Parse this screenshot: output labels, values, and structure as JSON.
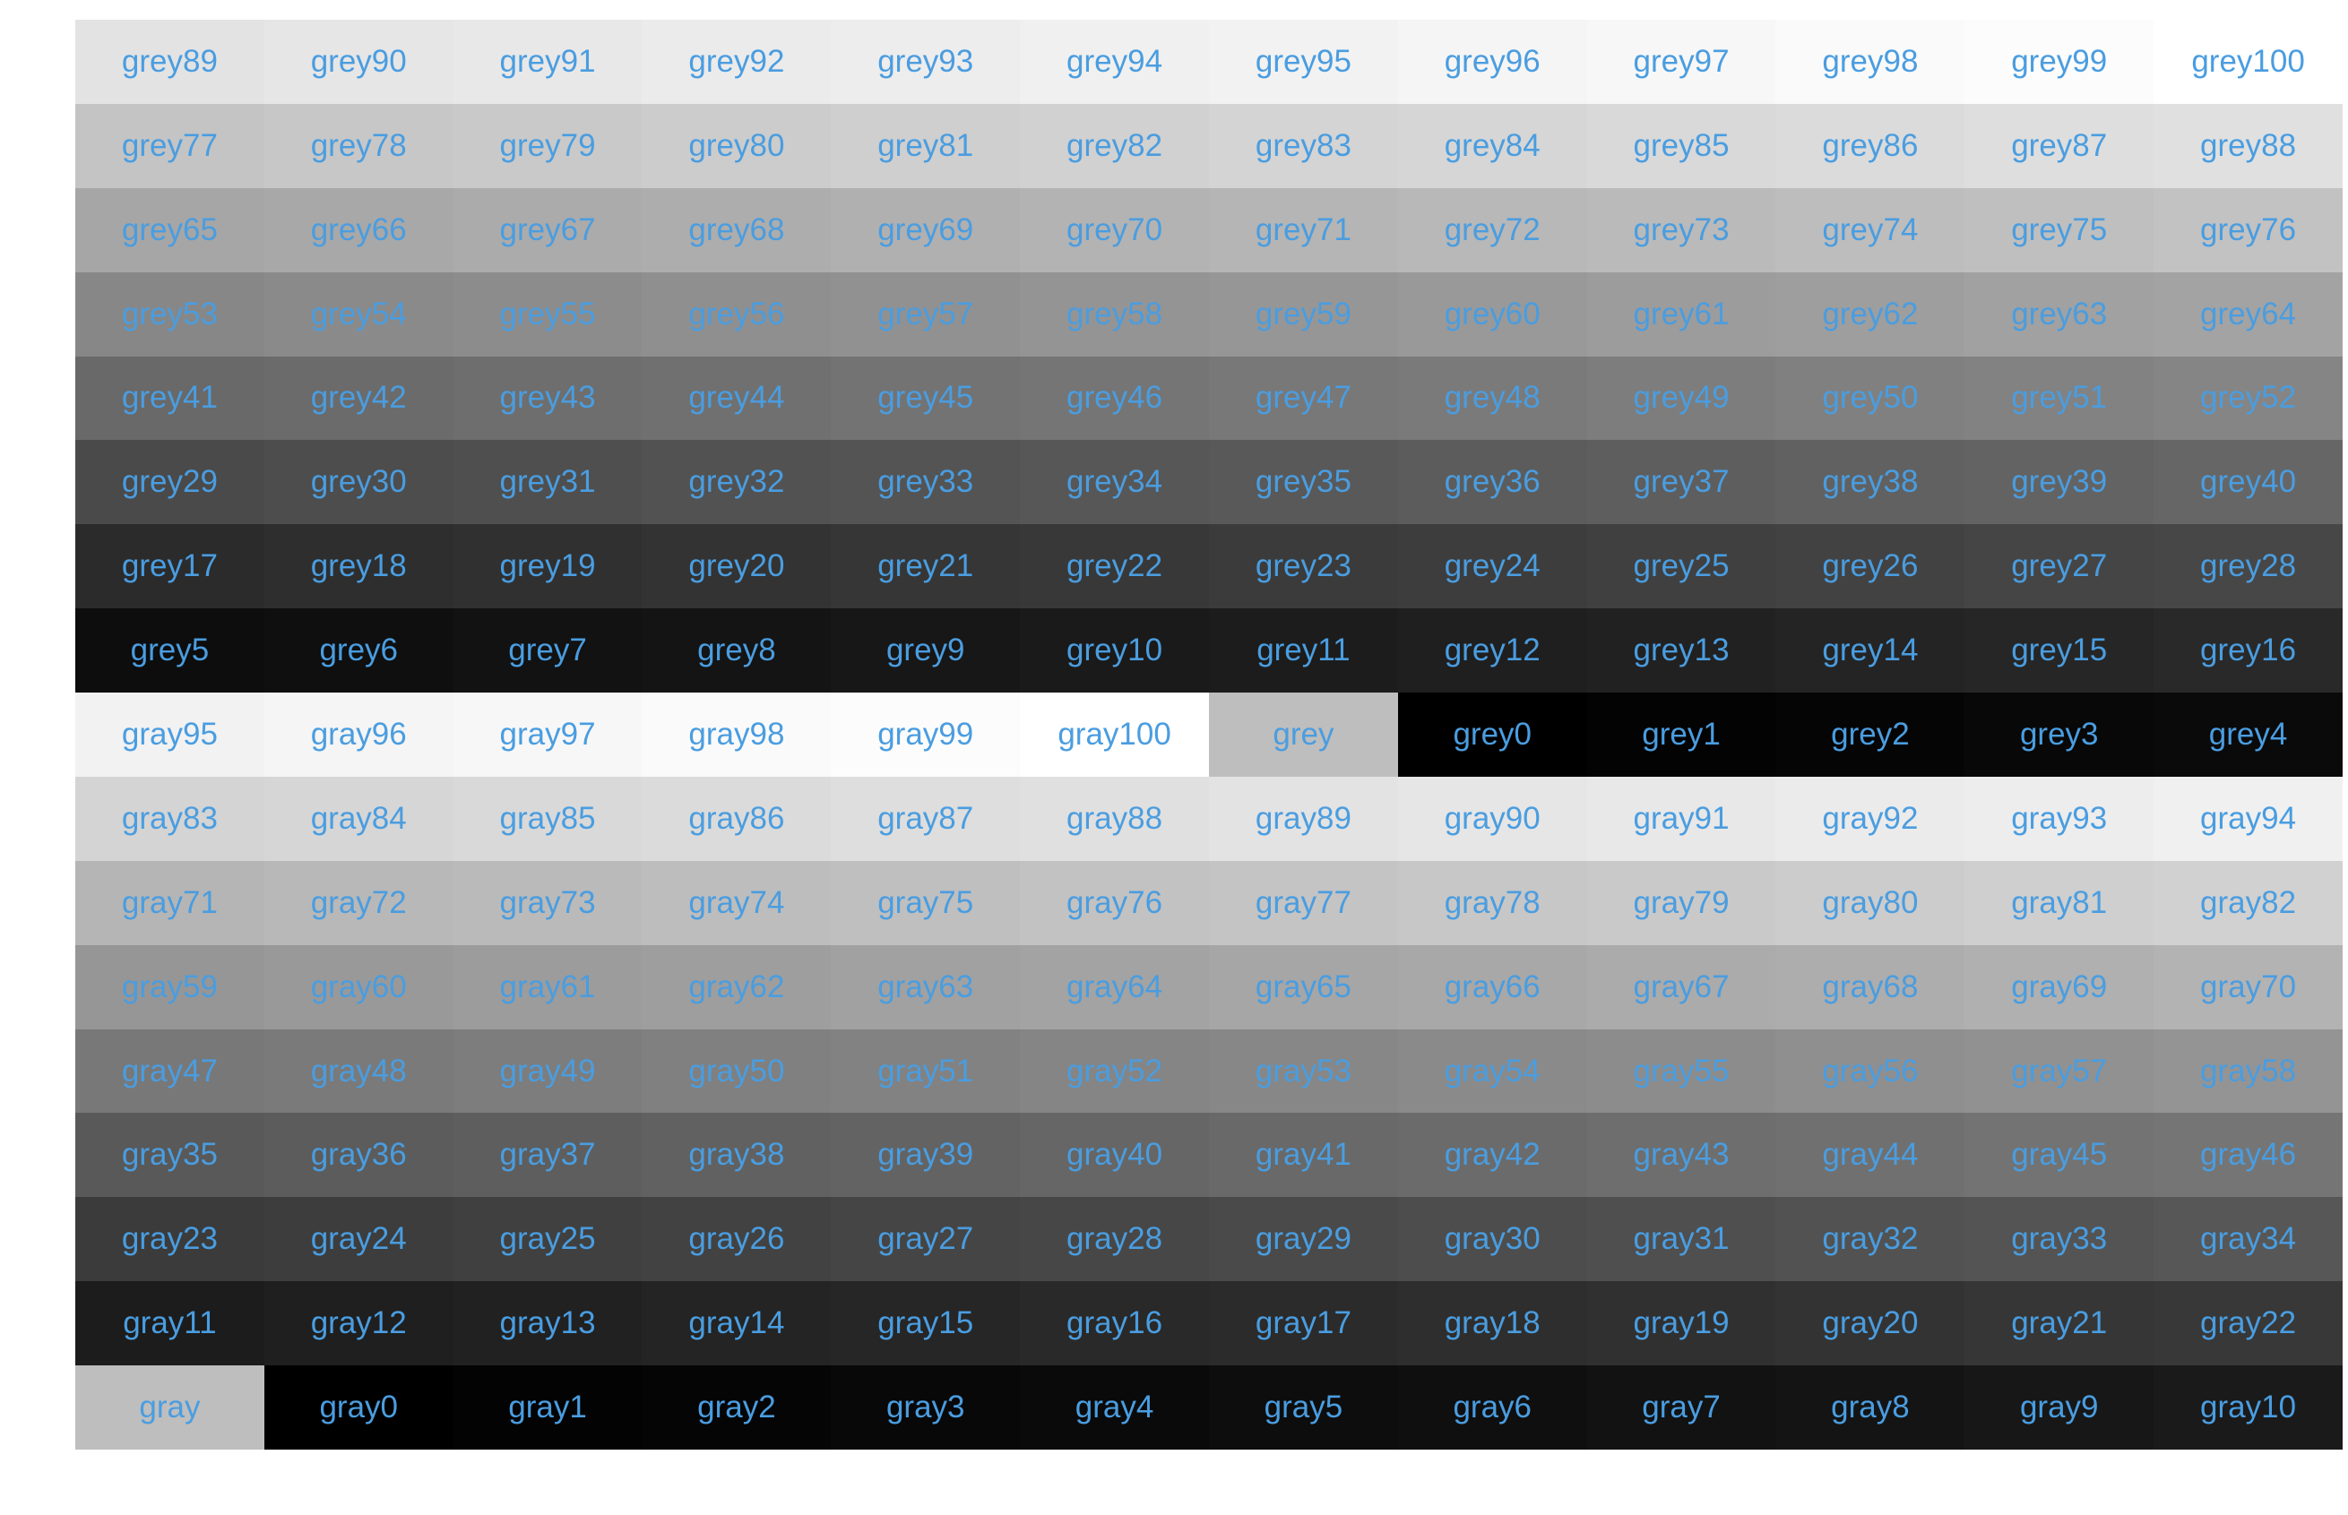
{
  "chart_data": {
    "type": "table",
    "label_color": "#4a9de0",
    "rows": [
      [
        {
          "name": "grey89",
          "value": 89
        },
        {
          "name": "grey90",
          "value": 90
        },
        {
          "name": "grey91",
          "value": 91
        },
        {
          "name": "grey92",
          "value": 92
        },
        {
          "name": "grey93",
          "value": 93
        },
        {
          "name": "grey94",
          "value": 94
        },
        {
          "name": "grey95",
          "value": 95
        },
        {
          "name": "grey96",
          "value": 96
        },
        {
          "name": "grey97",
          "value": 97
        },
        {
          "name": "grey98",
          "value": 98
        },
        {
          "name": "grey99",
          "value": 99
        },
        {
          "name": "grey100",
          "value": 100
        }
      ],
      [
        {
          "name": "grey77",
          "value": 77
        },
        {
          "name": "grey78",
          "value": 78
        },
        {
          "name": "grey79",
          "value": 79
        },
        {
          "name": "grey80",
          "value": 80
        },
        {
          "name": "grey81",
          "value": 81
        },
        {
          "name": "grey82",
          "value": 82
        },
        {
          "name": "grey83",
          "value": 83
        },
        {
          "name": "grey84",
          "value": 84
        },
        {
          "name": "grey85",
          "value": 85
        },
        {
          "name": "grey86",
          "value": 86
        },
        {
          "name": "grey87",
          "value": 87
        },
        {
          "name": "grey88",
          "value": 88
        }
      ],
      [
        {
          "name": "grey65",
          "value": 65
        },
        {
          "name": "grey66",
          "value": 66
        },
        {
          "name": "grey67",
          "value": 67
        },
        {
          "name": "grey68",
          "value": 68
        },
        {
          "name": "grey69",
          "value": 69
        },
        {
          "name": "grey70",
          "value": 70
        },
        {
          "name": "grey71",
          "value": 71
        },
        {
          "name": "grey72",
          "value": 72
        },
        {
          "name": "grey73",
          "value": 73
        },
        {
          "name": "grey74",
          "value": 74
        },
        {
          "name": "grey75",
          "value": 75
        },
        {
          "name": "grey76",
          "value": 76
        }
      ],
      [
        {
          "name": "grey53",
          "value": 53
        },
        {
          "name": "grey54",
          "value": 54
        },
        {
          "name": "grey55",
          "value": 55
        },
        {
          "name": "grey56",
          "value": 56
        },
        {
          "name": "grey57",
          "value": 57
        },
        {
          "name": "grey58",
          "value": 58
        },
        {
          "name": "grey59",
          "value": 59
        },
        {
          "name": "grey60",
          "value": 60
        },
        {
          "name": "grey61",
          "value": 61
        },
        {
          "name": "grey62",
          "value": 62
        },
        {
          "name": "grey63",
          "value": 63
        },
        {
          "name": "grey64",
          "value": 64
        }
      ],
      [
        {
          "name": "grey41",
          "value": 41
        },
        {
          "name": "grey42",
          "value": 42
        },
        {
          "name": "grey43",
          "value": 43
        },
        {
          "name": "grey44",
          "value": 44
        },
        {
          "name": "grey45",
          "value": 45
        },
        {
          "name": "grey46",
          "value": 46
        },
        {
          "name": "grey47",
          "value": 47
        },
        {
          "name": "grey48",
          "value": 48
        },
        {
          "name": "grey49",
          "value": 49
        },
        {
          "name": "grey50",
          "value": 50
        },
        {
          "name": "grey51",
          "value": 51
        },
        {
          "name": "grey52",
          "value": 52
        }
      ],
      [
        {
          "name": "grey29",
          "value": 29
        },
        {
          "name": "grey30",
          "value": 30
        },
        {
          "name": "grey31",
          "value": 31
        },
        {
          "name": "grey32",
          "value": 32
        },
        {
          "name": "grey33",
          "value": 33
        },
        {
          "name": "grey34",
          "value": 34
        },
        {
          "name": "grey35",
          "value": 35
        },
        {
          "name": "grey36",
          "value": 36
        },
        {
          "name": "grey37",
          "value": 37
        },
        {
          "name": "grey38",
          "value": 38
        },
        {
          "name": "grey39",
          "value": 39
        },
        {
          "name": "grey40",
          "value": 40
        }
      ],
      [
        {
          "name": "grey17",
          "value": 17
        },
        {
          "name": "grey18",
          "value": 18
        },
        {
          "name": "grey19",
          "value": 19
        },
        {
          "name": "grey20",
          "value": 20
        },
        {
          "name": "grey21",
          "value": 21
        },
        {
          "name": "grey22",
          "value": 22
        },
        {
          "name": "grey23",
          "value": 23
        },
        {
          "name": "grey24",
          "value": 24
        },
        {
          "name": "grey25",
          "value": 25
        },
        {
          "name": "grey26",
          "value": 26
        },
        {
          "name": "grey27",
          "value": 27
        },
        {
          "name": "grey28",
          "value": 28
        }
      ],
      [
        {
          "name": "grey5",
          "value": 5
        },
        {
          "name": "grey6",
          "value": 6
        },
        {
          "name": "grey7",
          "value": 7
        },
        {
          "name": "grey8",
          "value": 8
        },
        {
          "name": "grey9",
          "value": 9
        },
        {
          "name": "grey10",
          "value": 10
        },
        {
          "name": "grey11",
          "value": 11
        },
        {
          "name": "grey12",
          "value": 12
        },
        {
          "name": "grey13",
          "value": 13
        },
        {
          "name": "grey14",
          "value": 14
        },
        {
          "name": "grey15",
          "value": 15
        },
        {
          "name": "grey16",
          "value": 16
        }
      ],
      [
        {
          "name": "gray95",
          "value": 95
        },
        {
          "name": "gray96",
          "value": 96
        },
        {
          "name": "gray97",
          "value": 97
        },
        {
          "name": "gray98",
          "value": 98
        },
        {
          "name": "gray99",
          "value": 99
        },
        {
          "name": "gray100",
          "value": 100
        },
        {
          "name": "grey",
          "value": "#bebebe"
        },
        {
          "name": "grey0",
          "value": 0
        },
        {
          "name": "grey1",
          "value": 1
        },
        {
          "name": "grey2",
          "value": 2
        },
        {
          "name": "grey3",
          "value": 3
        },
        {
          "name": "grey4",
          "value": 4
        }
      ],
      [
        {
          "name": "gray83",
          "value": 83
        },
        {
          "name": "gray84",
          "value": 84
        },
        {
          "name": "gray85",
          "value": 85
        },
        {
          "name": "gray86",
          "value": 86
        },
        {
          "name": "gray87",
          "value": 87
        },
        {
          "name": "gray88",
          "value": 88
        },
        {
          "name": "gray89",
          "value": 89
        },
        {
          "name": "gray90",
          "value": 90
        },
        {
          "name": "gray91",
          "value": 91
        },
        {
          "name": "gray92",
          "value": 92
        },
        {
          "name": "gray93",
          "value": 93
        },
        {
          "name": "gray94",
          "value": 94
        }
      ],
      [
        {
          "name": "gray71",
          "value": 71
        },
        {
          "name": "gray72",
          "value": 72
        },
        {
          "name": "gray73",
          "value": 73
        },
        {
          "name": "gray74",
          "value": 74
        },
        {
          "name": "gray75",
          "value": 75
        },
        {
          "name": "gray76",
          "value": 76
        },
        {
          "name": "gray77",
          "value": 77
        },
        {
          "name": "gray78",
          "value": 78
        },
        {
          "name": "gray79",
          "value": 79
        },
        {
          "name": "gray80",
          "value": 80
        },
        {
          "name": "gray81",
          "value": 81
        },
        {
          "name": "gray82",
          "value": 82
        }
      ],
      [
        {
          "name": "gray59",
          "value": 59
        },
        {
          "name": "gray60",
          "value": 60
        },
        {
          "name": "gray61",
          "value": 61
        },
        {
          "name": "gray62",
          "value": 62
        },
        {
          "name": "gray63",
          "value": 63
        },
        {
          "name": "gray64",
          "value": 64
        },
        {
          "name": "gray65",
          "value": 65
        },
        {
          "name": "gray66",
          "value": 66
        },
        {
          "name": "gray67",
          "value": 67
        },
        {
          "name": "gray68",
          "value": 68
        },
        {
          "name": "gray69",
          "value": 69
        },
        {
          "name": "gray70",
          "value": 70
        }
      ],
      [
        {
          "name": "gray47",
          "value": 47
        },
        {
          "name": "gray48",
          "value": 48
        },
        {
          "name": "gray49",
          "value": 49
        },
        {
          "name": "gray50",
          "value": 50
        },
        {
          "name": "gray51",
          "value": 51
        },
        {
          "name": "gray52",
          "value": 52
        },
        {
          "name": "gray53",
          "value": 53
        },
        {
          "name": "gray54",
          "value": 54
        },
        {
          "name": "gray55",
          "value": 55
        },
        {
          "name": "gray56",
          "value": 56
        },
        {
          "name": "gray57",
          "value": 57
        },
        {
          "name": "gray58",
          "value": 58
        }
      ],
      [
        {
          "name": "gray35",
          "value": 35
        },
        {
          "name": "gray36",
          "value": 36
        },
        {
          "name": "gray37",
          "value": 37
        },
        {
          "name": "gray38",
          "value": 38
        },
        {
          "name": "gray39",
          "value": 39
        },
        {
          "name": "gray40",
          "value": 40
        },
        {
          "name": "gray41",
          "value": 41
        },
        {
          "name": "gray42",
          "value": 42
        },
        {
          "name": "gray43",
          "value": 43
        },
        {
          "name": "gray44",
          "value": 44
        },
        {
          "name": "gray45",
          "value": 45
        },
        {
          "name": "gray46",
          "value": 46
        }
      ],
      [
        {
          "name": "gray23",
          "value": 23
        },
        {
          "name": "gray24",
          "value": 24
        },
        {
          "name": "gray25",
          "value": 25
        },
        {
          "name": "gray26",
          "value": 26
        },
        {
          "name": "gray27",
          "value": 27
        },
        {
          "name": "gray28",
          "value": 28
        },
        {
          "name": "gray29",
          "value": 29
        },
        {
          "name": "gray30",
          "value": 30
        },
        {
          "name": "gray31",
          "value": 31
        },
        {
          "name": "gray32",
          "value": 32
        },
        {
          "name": "gray33",
          "value": 33
        },
        {
          "name": "gray34",
          "value": 34
        }
      ],
      [
        {
          "name": "gray11",
          "value": 11
        },
        {
          "name": "gray12",
          "value": 12
        },
        {
          "name": "gray13",
          "value": 13
        },
        {
          "name": "gray14",
          "value": 14
        },
        {
          "name": "gray15",
          "value": 15
        },
        {
          "name": "gray16",
          "value": 16
        },
        {
          "name": "gray17",
          "value": 17
        },
        {
          "name": "gray18",
          "value": 18
        },
        {
          "name": "gray19",
          "value": 19
        },
        {
          "name": "gray20",
          "value": 20
        },
        {
          "name": "gray21",
          "value": 21
        },
        {
          "name": "gray22",
          "value": 22
        }
      ],
      [
        {
          "name": "gray",
          "value": "#bebebe"
        },
        {
          "name": "gray0",
          "value": 0
        },
        {
          "name": "gray1",
          "value": 1
        },
        {
          "name": "gray2",
          "value": 2
        },
        {
          "name": "gray3",
          "value": 3
        },
        {
          "name": "gray4",
          "value": 4
        },
        {
          "name": "gray5",
          "value": 5
        },
        {
          "name": "gray6",
          "value": 6
        },
        {
          "name": "gray7",
          "value": 7
        },
        {
          "name": "gray8",
          "value": 8
        },
        {
          "name": "gray9",
          "value": 9
        },
        {
          "name": "gray10",
          "value": 10
        }
      ]
    ]
  }
}
